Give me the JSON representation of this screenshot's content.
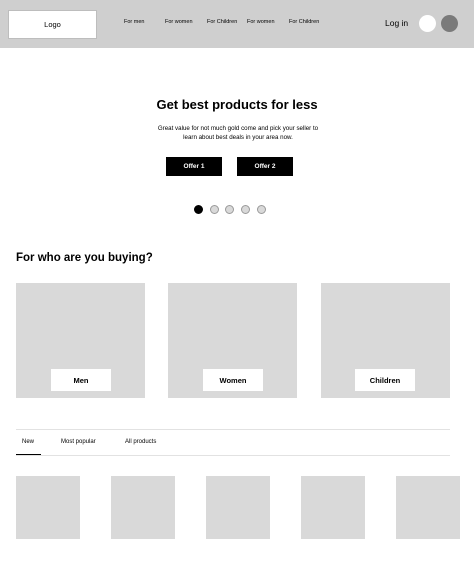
{
  "header": {
    "logo": "Logo",
    "nav": [
      "For men",
      "For women",
      "For Children",
      "For women",
      "For Children"
    ],
    "login": "Log in"
  },
  "hero": {
    "title": "Get best products for less",
    "text": "Great value for not much gold come and pick your seller to learn about best deals in your area now.",
    "offers": [
      "Offer 1",
      "Offer 2"
    ],
    "carousel": {
      "count": 5,
      "active_index": 0
    }
  },
  "categories": {
    "title": "For who are you buying?",
    "items": [
      "Men",
      "Women",
      "Children"
    ]
  },
  "tabs": {
    "items": [
      "New",
      "Most popular",
      "All products"
    ],
    "active": "New"
  },
  "colors": {
    "header_bg": "#cfcfcf",
    "placeholder": "#d9d9d9",
    "button": "#000000"
  }
}
